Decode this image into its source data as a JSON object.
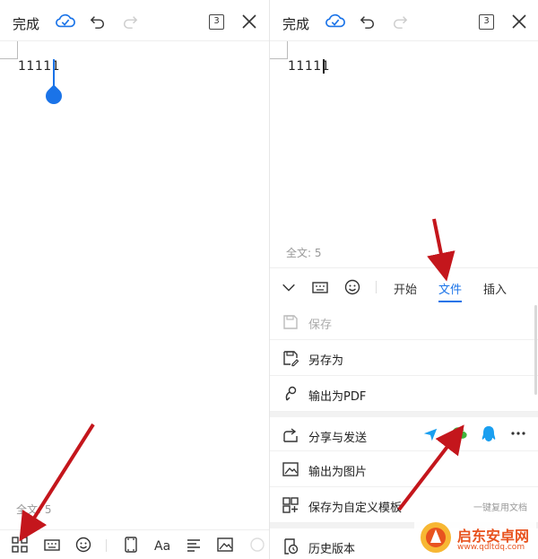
{
  "left": {
    "topbar": {
      "done_label": "完成",
      "page_count": "3"
    },
    "doc_text": "11111",
    "word_count": "全文: 5"
  },
  "right": {
    "topbar": {
      "done_label": "完成",
      "page_count": "3"
    },
    "doc_text": "11111",
    "word_count": "全文: 5",
    "tabs": [
      {
        "label": "开始",
        "active": false
      },
      {
        "label": "文件",
        "active": true
      },
      {
        "label": "插入",
        "active": false
      }
    ],
    "menu": {
      "save": "保存",
      "save_as": "另存为",
      "export_pdf": "输出为PDF",
      "share": "分享与发送",
      "export_image": "输出为图片",
      "save_template": "保存为自定义模板",
      "save_template_hint": "一键复用文档",
      "history": "历史版本"
    }
  },
  "watermark": {
    "title": "启东安卓网",
    "url": "www.qdltdq.com"
  },
  "colors": {
    "accent": "#1a73e8",
    "arrow": "#c4161c",
    "wechat": "#3fb43c",
    "qq": "#1a9ff0",
    "watermark": "#e8531f"
  }
}
